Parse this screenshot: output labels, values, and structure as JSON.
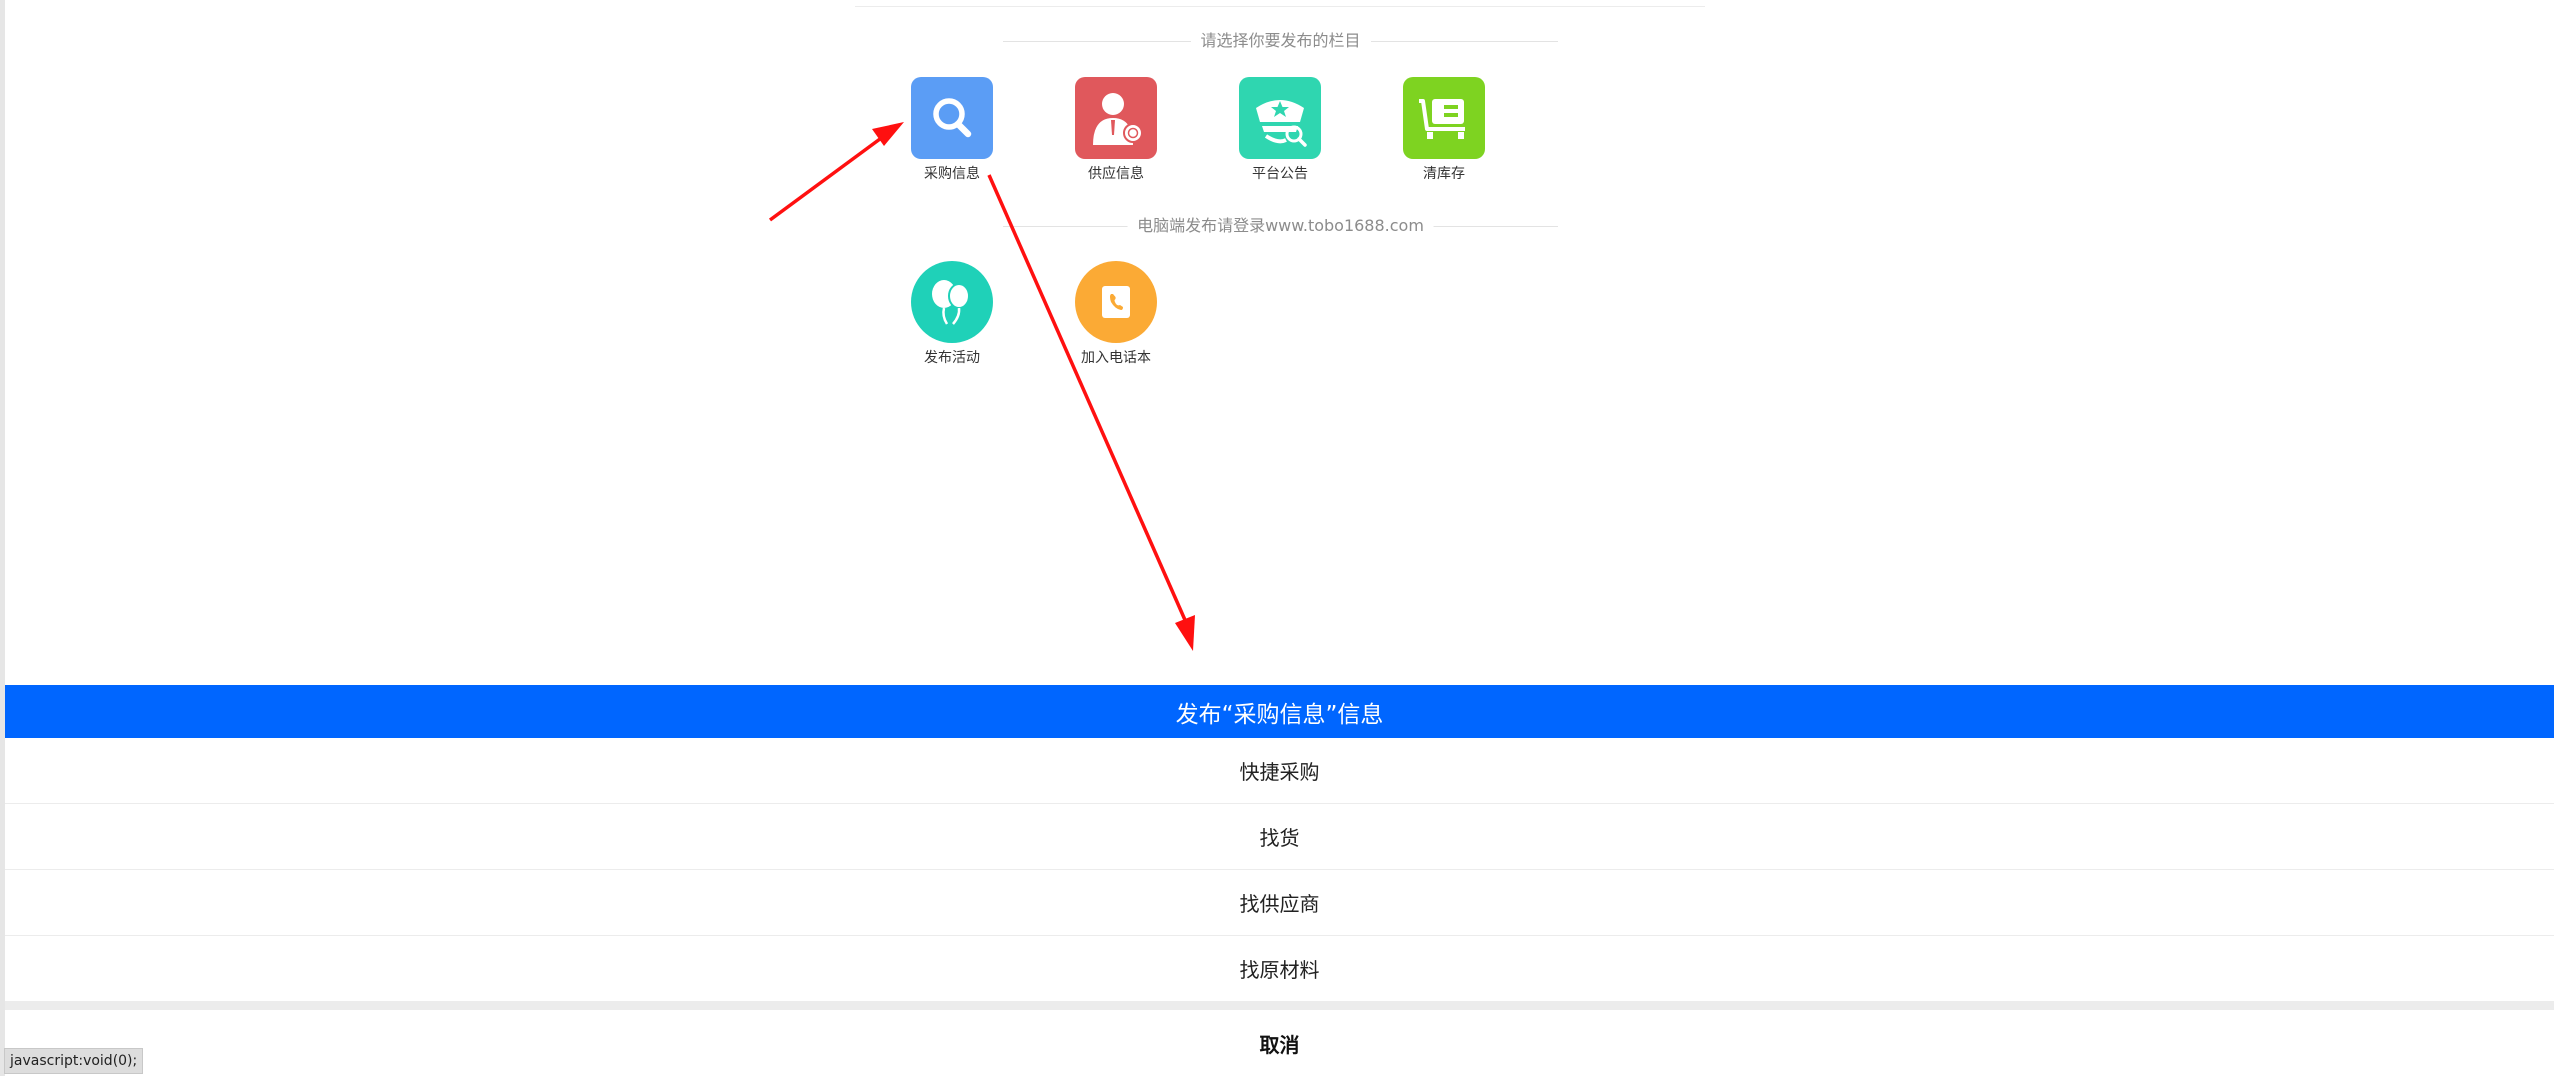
{
  "sections": {
    "publish_heading": "请选择你要发布的栏目",
    "pc_notice": "电脑端发布请登录www.tobo1688.com"
  },
  "tiles": [
    {
      "label": "采购信息",
      "icon": "search-icon",
      "color": "#5b9df5"
    },
    {
      "label": "供应信息",
      "icon": "supplier-person-icon",
      "color": "#e0585c"
    },
    {
      "label": "平台公告",
      "icon": "announcement-cap-icon",
      "color": "#2fd6b0"
    },
    {
      "label": "清库存",
      "icon": "cart-icon",
      "color": "#7ed321"
    },
    {
      "label": "发布活动",
      "icon": "balloons-icon",
      "color": "#1fd1b8"
    },
    {
      "label": "加入电话本",
      "icon": "phonebook-icon",
      "color": "#fbaa35"
    }
  ],
  "sheet": {
    "title": "发布“采购信息”信息",
    "options": [
      "快捷采购",
      "找货",
      "找供应商",
      "找原材料"
    ],
    "cancel": "取消"
  },
  "status_bar": {
    "link": "javascript:void(0);"
  },
  "colors": {
    "primary": "#0066ff",
    "annotation_arrow": "#ff1010"
  }
}
